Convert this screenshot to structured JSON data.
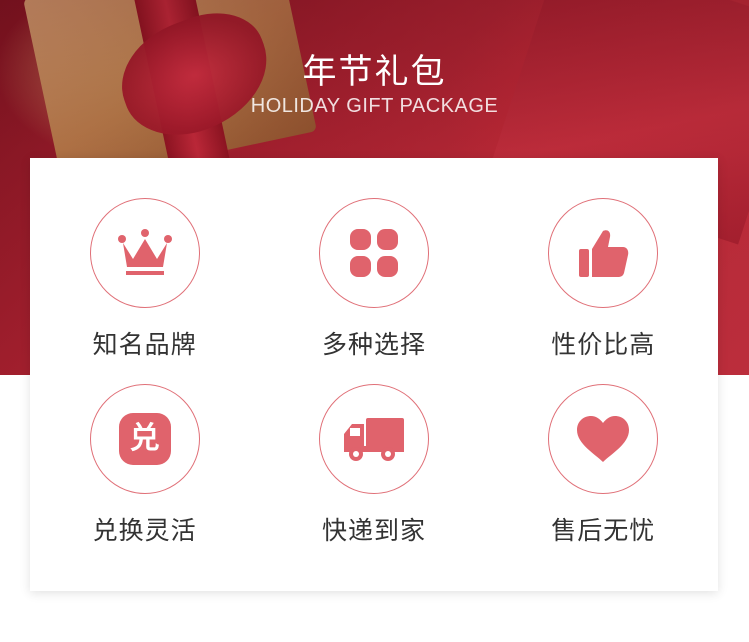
{
  "header": {
    "title": "年节礼包",
    "subtitle": "HOLIDAY GIFT PACKAGE"
  },
  "features": [
    {
      "label": "知名品牌",
      "icon": "crown-icon"
    },
    {
      "label": "多种选择",
      "icon": "four-dots-grid-icon"
    },
    {
      "label": "性价比高",
      "icon": "thumbs-up-icon"
    },
    {
      "label": "兑换灵活",
      "icon": "exchange-badge-icon",
      "badge_text": "兑"
    },
    {
      "label": "快递到家",
      "icon": "delivery-truck-icon"
    },
    {
      "label": "售后无忧",
      "icon": "heart-icon"
    }
  ],
  "colors": {
    "accent": "#e0636c",
    "circle_border": "#e07078",
    "label_text": "#333333",
    "hero_red": "#b92a38"
  }
}
